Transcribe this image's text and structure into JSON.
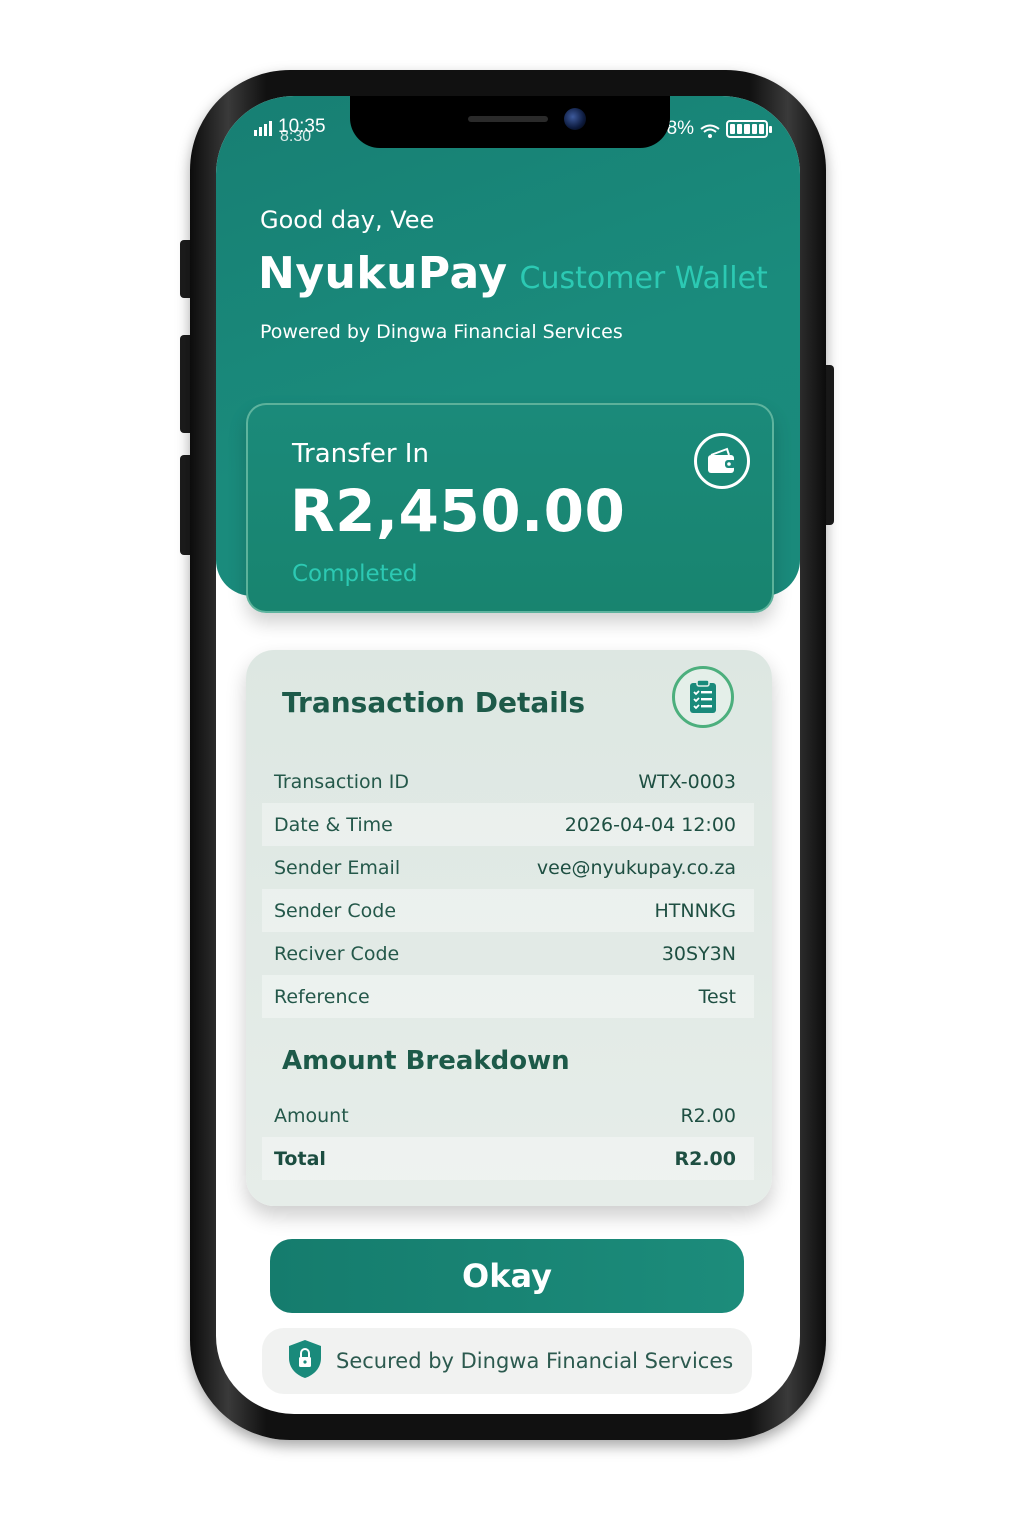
{
  "status_bar": {
    "time": "10:35",
    "time_overlay": "8:30",
    "battery_text": "98%"
  },
  "header": {
    "greeting": "Good day, Vee",
    "brand": "NyukuPay",
    "brand_sub": "Customer Wallet",
    "powered_by": "Powered by Dingwa Financial Services"
  },
  "transfer": {
    "label": "Transfer In",
    "amount": "R2,450.00",
    "status": "Completed",
    "icon": "wallet-icon"
  },
  "details": {
    "title": "Transaction Details",
    "icon": "clipboard-checklist-icon",
    "rows": [
      {
        "label": "Transaction ID",
        "value": "WTX-0003"
      },
      {
        "label": "Date & Time",
        "value": "2026-04-04 12:00"
      },
      {
        "label": "Sender Email",
        "value": "vee@nyukupay.co.za"
      },
      {
        "label": "Sender Code",
        "value": "HTNNKG"
      },
      {
        "label": "Reciver Code",
        "value": "30SY3N"
      },
      {
        "label": "Reference",
        "value": "Test"
      }
    ]
  },
  "breakdown": {
    "title": "Amount Breakdown",
    "rows": [
      {
        "label": "Amount",
        "value": "R2.00"
      },
      {
        "label": "Total",
        "value": "R2.00"
      }
    ]
  },
  "actions": {
    "okay_label": "Okay"
  },
  "footer": {
    "secure_text": "Secured by Dingwa Financial Services",
    "icon": "shield-lock-icon"
  },
  "colors": {
    "primary": "#1a8a7b",
    "accent": "#2cc9b3",
    "text_dark": "#1d5a49"
  }
}
